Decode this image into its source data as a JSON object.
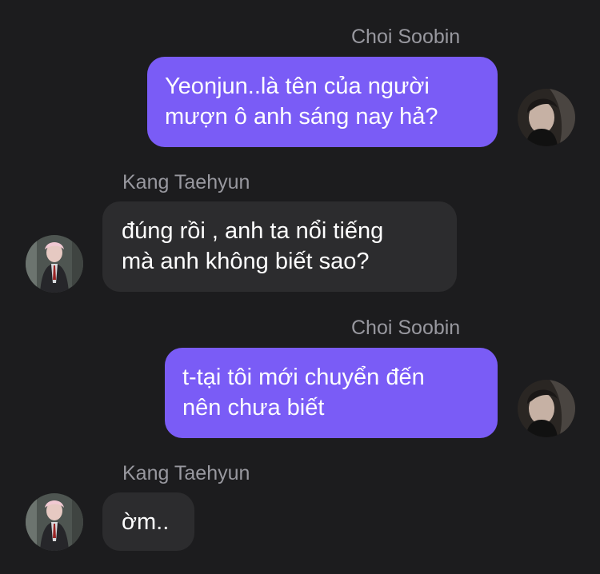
{
  "messages": [
    {
      "sender": "Choi Soobin",
      "side": "outgoing",
      "lines": [
        "Yeonjun..là tên của người",
        "mượn ô anh sáng nay hả?"
      ],
      "avatar": "soobin-avatar"
    },
    {
      "sender": "Kang Taehyun",
      "side": "incoming",
      "lines": [
        "đúng rồi , anh ta nổi tiếng",
        "mà anh không biết sao?"
      ],
      "avatar": "taehyun-avatar"
    },
    {
      "sender": "Choi Soobin",
      "side": "outgoing",
      "lines": [
        "t-tại tôi mới chuyển đến",
        "nên chưa biết"
      ],
      "avatar": "soobin-avatar"
    },
    {
      "sender": "Kang Taehyun",
      "side": "incoming",
      "lines": [
        "ờm.."
      ],
      "avatar": "taehyun-avatar"
    }
  ],
  "colors": {
    "background": "#1c1c1e",
    "outgoing_bubble": "#7a5cf6",
    "incoming_bubble": "#2c2c2e",
    "sender_name": "#98989f"
  }
}
